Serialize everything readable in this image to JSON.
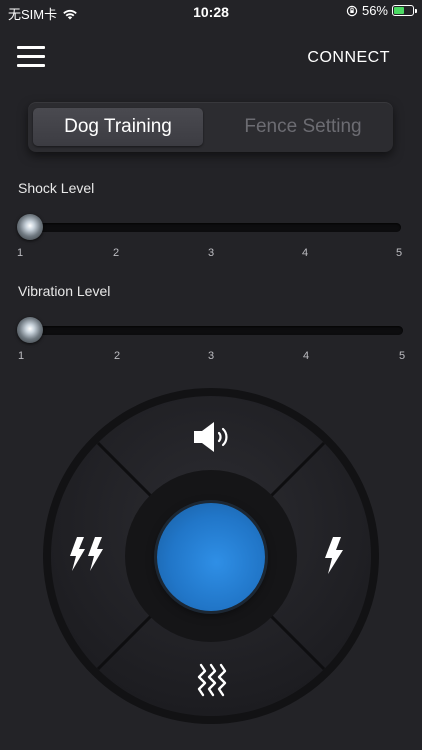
{
  "status_bar": {
    "carrier": "无SIM卡",
    "time": "10:28",
    "battery_percent": "56%",
    "battery_level": 0.56,
    "wifi_icon": "wifi-icon",
    "lock_icon": "orientation-lock-icon"
  },
  "header": {
    "menu_icon": "hamburger-menu-icon",
    "connect_label": "CONNECT"
  },
  "tabs": [
    {
      "label": "Dog Training",
      "active": true
    },
    {
      "label": "Fence Setting",
      "active": false
    }
  ],
  "sliders": {
    "shock": {
      "label": "Shock Level",
      "ticks": [
        "1",
        "2",
        "3",
        "4",
        "5"
      ],
      "value": 1
    },
    "vibration": {
      "label": "Vibration Level",
      "ticks": [
        "1",
        "2",
        "3",
        "4",
        "5"
      ],
      "value": 1
    }
  },
  "control_pad": {
    "top": "speaker-icon",
    "left": "double-lightning-icon",
    "right": "lightning-icon",
    "bottom": "vibration-icon",
    "center": "main-action-button"
  },
  "colors": {
    "background": "#232327",
    "accent_blue": "#2a86dc",
    "inactive_tab_text": "#6c6c72"
  }
}
